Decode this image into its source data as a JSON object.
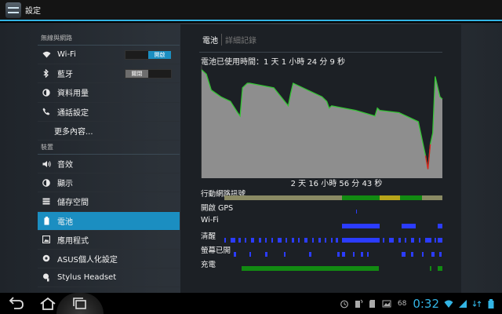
{
  "app": {
    "title": "設定"
  },
  "sidebar": {
    "sections": [
      {
        "header": "無線與網路",
        "items": [
          {
            "label": "Wi-Fi",
            "icon": "wifi-icon",
            "toggle": "開啟",
            "toggle_state": "on"
          },
          {
            "label": "藍牙",
            "icon": "bluetooth-icon",
            "toggle": "關閉",
            "toggle_state": "off"
          },
          {
            "label": "資料用量",
            "icon": "data-usage-icon"
          },
          {
            "label": "通話設定",
            "icon": "phone-icon"
          },
          {
            "label": "更多內容...",
            "icon": ""
          }
        ]
      },
      {
        "header": "裝置",
        "items": [
          {
            "label": "音效",
            "icon": "speaker-icon"
          },
          {
            "label": "顯示",
            "icon": "display-icon"
          },
          {
            "label": "儲存空間",
            "icon": "storage-icon"
          },
          {
            "label": "電池",
            "icon": "battery-icon",
            "selected": true
          },
          {
            "label": "應用程式",
            "icon": "apps-icon"
          },
          {
            "label": "ASUS個人化設定",
            "icon": "asus-customize-icon"
          },
          {
            "label": "Stylus Headset",
            "icon": "stylus-icon"
          }
        ]
      }
    ]
  },
  "panel": {
    "tab_battery": "電池",
    "tab_detail": "詳細記錄",
    "uptime": "電池已使用時間：1 天 1 小時 24 分 9 秒",
    "duration": "2 天 16 小時 56 分 43 秒",
    "signals": [
      "行動網路訊號",
      "開啟 GPS",
      "Wi-Fi",
      "清醒",
      "螢幕已開",
      "充電"
    ]
  },
  "status": {
    "battery_pct": "68",
    "clock": "0:32"
  },
  "colors": {
    "accent": "#33b5e5",
    "selected": "#1b8ec1",
    "graph_fill": "#8e8e8e",
    "graph_line": "#35c435",
    "wifi": "#2b3cff",
    "charging": "#128a12"
  },
  "chart_data": {
    "type": "area",
    "title": "",
    "xlabel": "",
    "ylabel": "",
    "ylim": [
      0,
      100
    ],
    "x_fraction": [
      0,
      0.02,
      0.04,
      0.08,
      0.12,
      0.15,
      0.16,
      0.17,
      0.19,
      0.2,
      0.3,
      0.36,
      0.37,
      0.38,
      0.44,
      0.5,
      0.52,
      0.53,
      0.54,
      0.64,
      0.72,
      0.73,
      0.74,
      0.82,
      0.9,
      0.93,
      0.94,
      0.95,
      0.96,
      0.97,
      0.99,
      1.0
    ],
    "battery_level_pct": [
      96,
      92,
      78,
      72,
      68,
      58,
      55,
      80,
      84,
      84,
      80,
      64,
      75,
      84,
      78,
      72,
      68,
      62,
      64,
      60,
      55,
      62,
      60,
      58,
      50,
      20,
      8,
      30,
      40,
      90,
      72,
      70
    ]
  }
}
